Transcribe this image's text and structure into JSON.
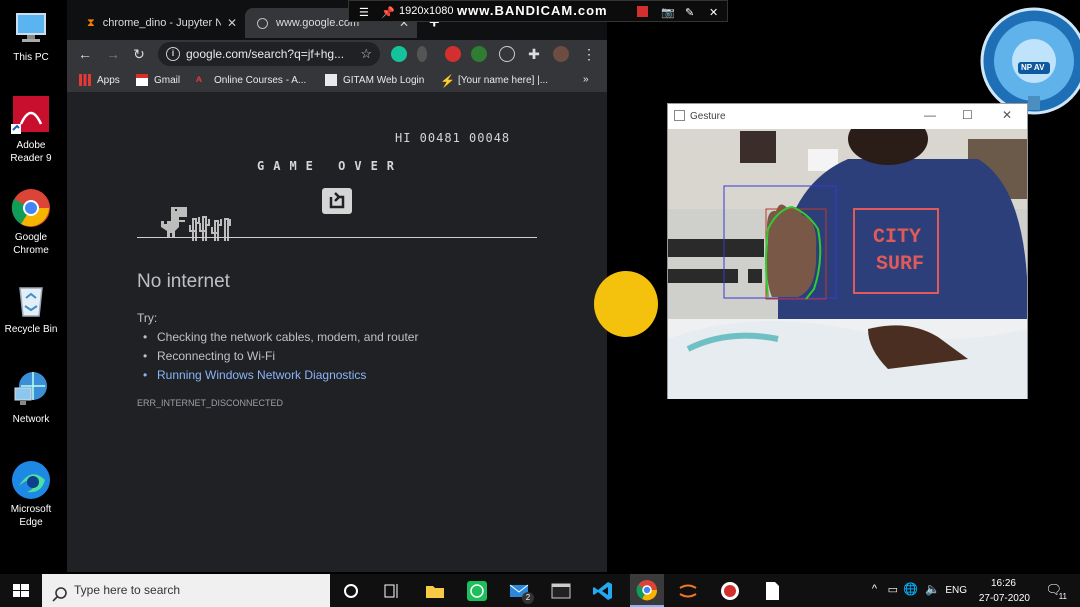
{
  "desktop": {
    "icons": [
      {
        "label": "This PC",
        "icon": "computer-icon"
      },
      {
        "label": "Adobe Reader 9",
        "icon": "pdf-icon"
      },
      {
        "label": "Google Chrome",
        "icon": "chrome-icon"
      },
      {
        "label": "Recycle Bin",
        "icon": "recycle-bin-icon"
      },
      {
        "label": "Network",
        "icon": "network-icon"
      },
      {
        "label": "Microsoft Edge",
        "icon": "edge-icon"
      }
    ]
  },
  "chrome": {
    "tabs": [
      {
        "label": "chrome_dino - Jupyter No",
        "icon": "hourglass-icon",
        "active": false
      },
      {
        "label": "www.google.com",
        "icon": "globe-icon",
        "active": true
      }
    ],
    "new_tab": "+",
    "url": "google.com/search?q=jf+hg...",
    "bookmarks": [
      "Apps",
      "Gmail",
      "Online Courses - A...",
      "GITAM Web Login",
      "[Your name here] |..."
    ],
    "bookmarks_more": "»",
    "page": {
      "hi_score": "HI 00481 00048",
      "game_over": "GAME OVER",
      "title": "No internet",
      "try_label": "Try:",
      "tips": [
        "Checking the network cables, modem, and router",
        "Reconnecting to Wi-Fi",
        "Running Windows Network Diagnostics"
      ],
      "error_code": "ERR_INTERNET_DISCONNECTED"
    }
  },
  "bandicam": {
    "resolution": "1920x1080",
    "watermark": "www.BANDICAM.com"
  },
  "widget": {
    "badge": "NP AV"
  },
  "gesture_window": {
    "title": "Gesture",
    "shirt_text_line1": "CITY",
    "shirt_text_line2": "SURF"
  },
  "taskbar": {
    "search_placeholder": "Type here to search",
    "mail_badge": "2",
    "language": "ENG",
    "time": "16:26",
    "date": "27-07-2020",
    "notification_count": "11"
  },
  "colors": {
    "chrome_bg": "#202124",
    "link_blue": "#8ab4f8",
    "yellow_dot": "#f4c20d",
    "tracking_box": "#3a3acc",
    "hand_contour": "#2ecc2e"
  }
}
